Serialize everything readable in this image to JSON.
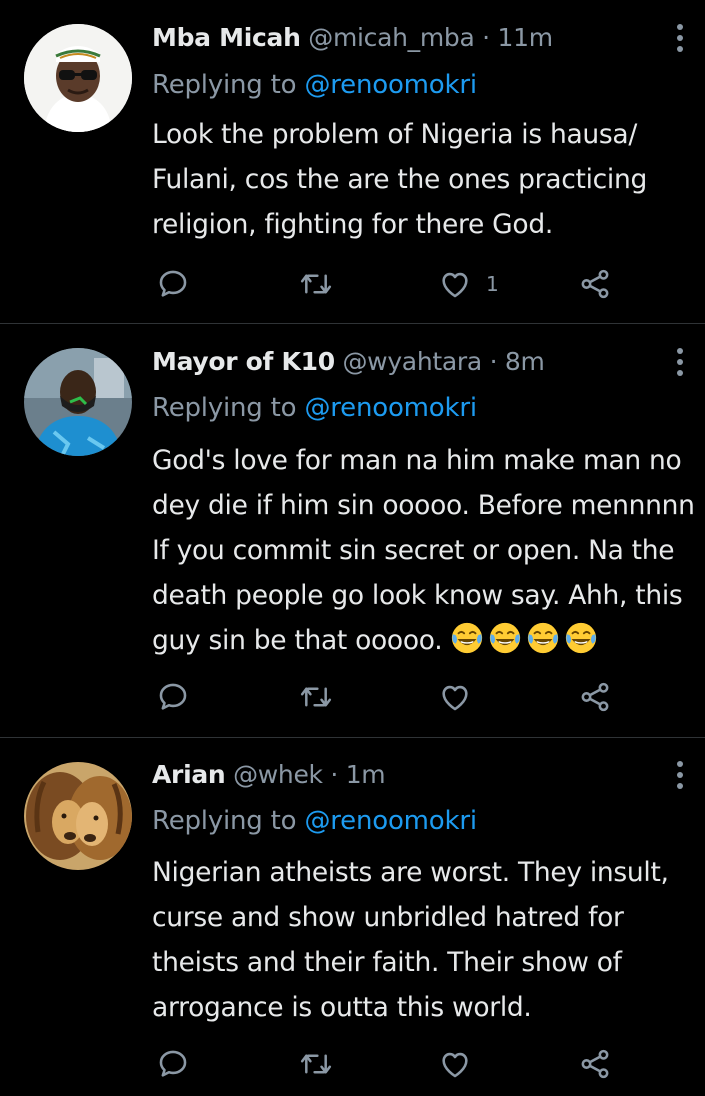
{
  "tweets": [
    {
      "name": "Mba Micah",
      "handle": "@micah_mba",
      "dot": "·",
      "time": "11m",
      "replying_prefix": "Replying to ",
      "replying_to": "@renoomokri",
      "text": "Look the problem of Nigeria is hausa/ Fulani, cos the are the ones practicing religion, fighting for there God.",
      "like_count": "1",
      "avatar": "avatar-man-cap-sunglasses"
    },
    {
      "name": "Mayor of K10",
      "handle": "@wyahtara",
      "dot": "·",
      "time": "8m",
      "replying_prefix": "Replying to ",
      "replying_to": "@renoomokri",
      "text": "God's love for man na him make man no dey die if him sin ooooo. Before mennnnn If you commit sin secret or open. Na the death people go look know say. Ahh, this guy sin be that ooooo.",
      "emoji": "face-with-tears-of-joy",
      "emoji_count": 4,
      "like_count": "",
      "avatar": "avatar-man-green-mask"
    },
    {
      "name": "Arian",
      "handle": "@whek",
      "dot": "·",
      "time": "1m",
      "replying_prefix": "Replying to ",
      "replying_to": "@renoomokri",
      "text": "Nigerian atheists are worst. They insult, curse and show unbridled hatred for theists and their faith. Their show of arrogance is outta this world.",
      "like_count": "",
      "avatar": "avatar-lions"
    }
  ],
  "colors": {
    "background": "#000000",
    "text": "#e7e9ea",
    "secondary": "#8b98a5",
    "link": "#1d9bf0",
    "divider": "#2f3336"
  },
  "icons": {
    "reply": "reply-icon",
    "retweet": "retweet-icon",
    "like": "heart-icon",
    "share": "share-icon",
    "more": "more-vertical-icon"
  }
}
